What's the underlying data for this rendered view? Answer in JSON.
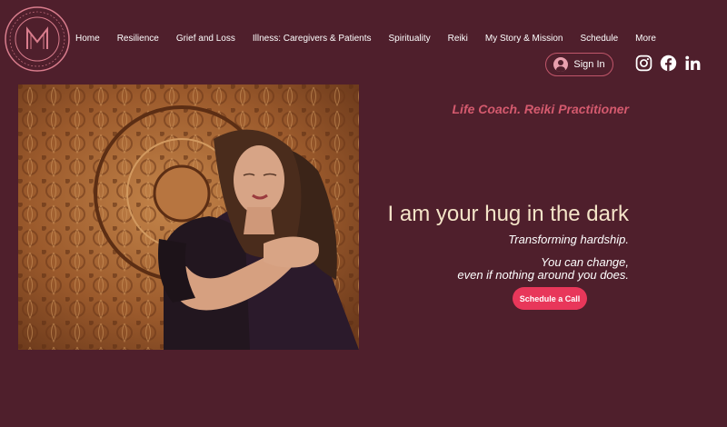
{
  "logo": {
    "text_ring": "DARE TO BE ME COACHING",
    "monogram": "M"
  },
  "nav": {
    "items": [
      {
        "label": "Home"
      },
      {
        "label": "Resilience"
      },
      {
        "label": "Grief and Loss"
      },
      {
        "label": "Illness: Caregivers & Patients"
      },
      {
        "label": "Spirituality"
      },
      {
        "label": "Reiki"
      },
      {
        "label": "My Story & Mission"
      },
      {
        "label": "Schedule"
      },
      {
        "label": "More"
      }
    ]
  },
  "auth": {
    "sign_in_label": "Sign In"
  },
  "social": [
    "instagram-icon",
    "facebook-icon",
    "linkedin-icon"
  ],
  "hero": {
    "tagline": "Life Coach. Reiki Practitioner",
    "headline": "I am your hug in the dark",
    "subline": "Transforming hardship.",
    "message_line1": "You can change,",
    "message_line2": "even if nothing around you does.",
    "cta_label": "Schedule a Call",
    "image": "photo of two women hugging in front of carved wooden panel"
  },
  "colors": {
    "background": "#4f1f2c",
    "accent": "#e8375a",
    "tagline": "#d45a6e",
    "headline": "#f4e4c8"
  }
}
